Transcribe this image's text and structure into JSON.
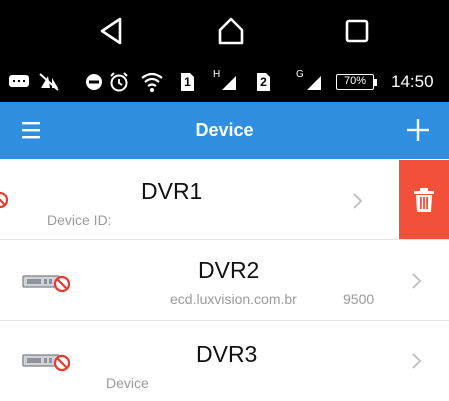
{
  "system_nav": {
    "back_icon": "back-triangle-icon",
    "home_icon": "home-icon",
    "recents_icon": "recents-square-icon"
  },
  "status_bar": {
    "sim1_label": "1",
    "sim1_network": "H",
    "sim2_label": "2",
    "sim2_network": "G",
    "battery": "70%",
    "time": "14:50"
  },
  "app_bar": {
    "title": "Device",
    "menu_icon": "hamburger-menu-icon",
    "add_icon": "plus-icon",
    "color": "#2f8ee0"
  },
  "devices": [
    {
      "name": "DVR1",
      "subtitle": "Device ID:",
      "status": "offline"
    },
    {
      "name": "DVR2",
      "subtitle": "ecd.luxvision.com.br",
      "port": "9500",
      "status": "offline"
    },
    {
      "name": "DVR3",
      "subtitle": "Device",
      "status": "offline"
    }
  ],
  "swipe_action": {
    "icon": "trash-icon",
    "color": "#f2503b"
  }
}
